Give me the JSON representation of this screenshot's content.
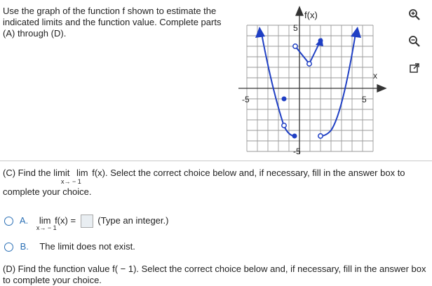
{
  "prompt": {
    "line1": "Use the graph of the function f shown to estimate the",
    "line2": "indicated limits and the function value. Complete parts",
    "line3": "(A) through (D)."
  },
  "graph": {
    "y_label": "f(x)",
    "x_label": "x",
    "tick_pos": "5",
    "tick_neg": "-5",
    "y_tick_top": "5",
    "y_tick_bottom": "-5"
  },
  "tools": {
    "icons": [
      "zoom-in-icon",
      "zoom-out-icon",
      "popout-icon"
    ]
  },
  "part_c": {
    "text_before": "(C) Find the limit",
    "lim_word": "lim",
    "lim_sub": "x→ − 1",
    "lim_expr": "f(x).",
    "text_after": "Select the correct choice below and, if necessary, fill in the answer box to",
    "line2": "complete your choice."
  },
  "choices": {
    "a": {
      "letter": "A.",
      "lim_word": "lim",
      "lim_sub": "x→ − 1",
      "expr": "f(x) =",
      "hint": "(Type an integer.)"
    },
    "b": {
      "letter": "B.",
      "text": "The limit does not exist."
    }
  },
  "part_d": {
    "text": "(D) Find the function value f( − 1). Select the correct choice below and, if necessary, fill in the answer box",
    "line2": "to complete your choice."
  },
  "colors": {
    "accent": "#2a6fb5",
    "curve": "#1f3fc4"
  }
}
